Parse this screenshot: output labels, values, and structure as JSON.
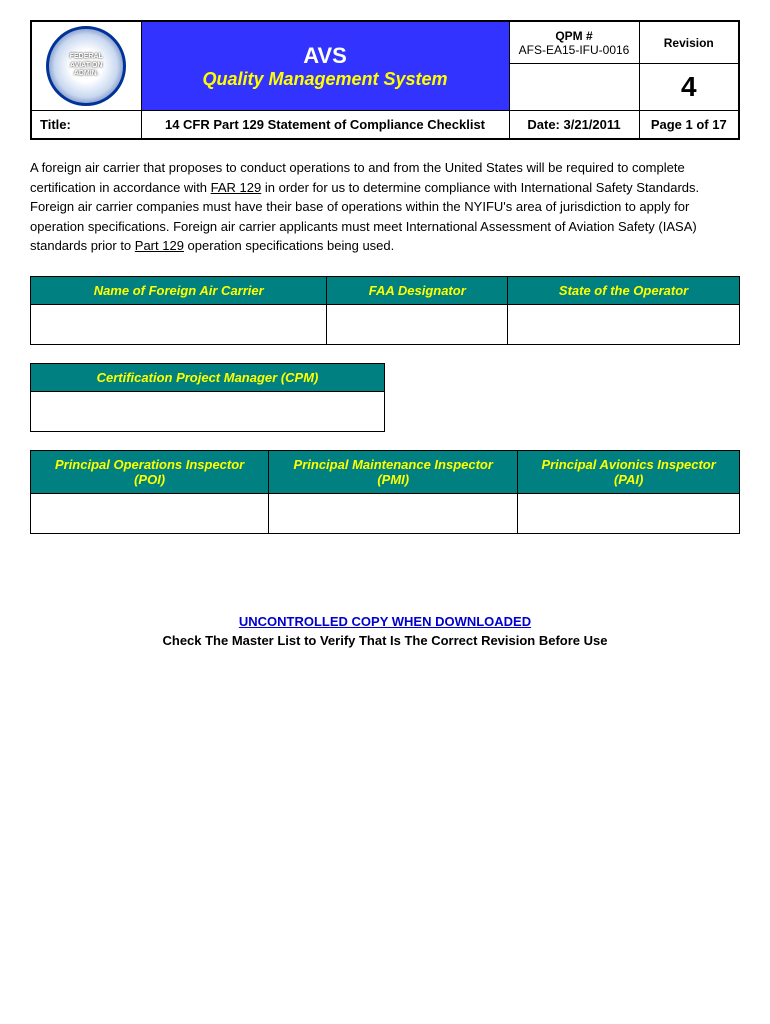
{
  "header": {
    "logo_alt": "FAA Seal",
    "logo_text": "FEDERAL AVIATION ADMINISTRATION",
    "title_avs": "AVS",
    "title_qms": "Quality Management System",
    "qpm_label": "QPM #",
    "qpm_number": "AFS-EA15-IFU-0016",
    "revision_label": "Revision",
    "revision_number": "4"
  },
  "title_row": {
    "title_label": "Title:",
    "title_value": "14 CFR Part 129 Statement of Compliance Checklist",
    "date_label": "Date: 3/21/2011",
    "page_label": "Page 1 of 17"
  },
  "body_text": {
    "paragraph": "A foreign air carrier that proposes to conduct operations to and from the United States will be required to complete certification in accordance with FAR 129 in order for us to determine compliance with International Safety Standards. Foreign air carrier companies must have their base of operations within the NYIFU's area of jurisdiction to apply for operation specifications. Foreign air carrier applicants must meet International Assessment of Aviation Safety (IASA) standards prior to Part 129 operation specifications being used."
  },
  "table1": {
    "col1_header": "Name of Foreign Air Carrier",
    "col2_header": "FAA Designator",
    "col3_header": "State of the Operator"
  },
  "table2": {
    "col1_header": "Certification Project Manager (CPM)"
  },
  "table3": {
    "col1_header": "Principal Operations Inspector (POI)",
    "col2_header": "Principal Maintenance Inspector (PMI)",
    "col3_header": "Principal Avionics Inspector (PAI)"
  },
  "footer": {
    "controlled_text": "UNCONTROLLED COPY WHEN DOWNLOADED",
    "check_text": "Check The Master List to Verify That Is The Correct Revision Before Use"
  }
}
